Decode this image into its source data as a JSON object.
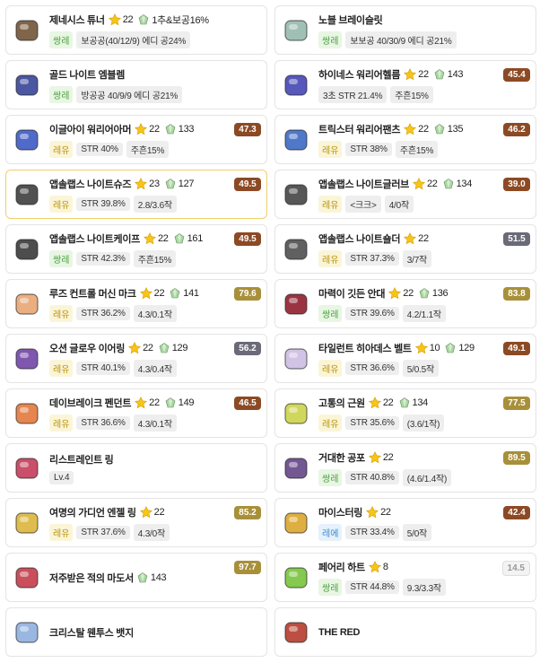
{
  "items": [
    {
      "name": "제네시스 튜너",
      "stars": "22",
      "pot": "1추&보공16%",
      "grade": "쌍레",
      "grade_type": "legend",
      "stats": [
        "보공공(40/12/9) 에디 공24%"
      ],
      "icon": "genesis-tuner-icon",
      "icon_color": "#6b4a2a"
    },
    {
      "name": "노블 브레이슬릿",
      "grade": "쌍레",
      "grade_type": "legend",
      "stats": [
        "보보공 40/30/9 에디 공21%"
      ],
      "icon": "noble-bracelet-icon",
      "icon_color": "#8fb5a8"
    },
    {
      "name": "골드 나이트 엠블렘",
      "grade": "쌍레",
      "grade_type": "legend",
      "stats": [
        "방공공 40/9/9 에디 공21%"
      ],
      "icon": "gold-knight-emblem-icon",
      "icon_color": "#2b3a8f"
    },
    {
      "name": "하이네스 워리어헬름",
      "stars": "22",
      "pot": "143",
      "grade": "3초 STR 21.4%",
      "grade_type": "chip",
      "stats": [
        "주흔15%"
      ],
      "score": "45.4",
      "score_type": "brown",
      "icon": "warrior-helm-icon",
      "icon_color": "#3a3ab0"
    },
    {
      "name": "이글아이 워리어아머",
      "stars": "22",
      "pot": "133",
      "grade": "레유",
      "grade_type": "unique",
      "stats": [
        "STR 40%",
        "주흔15%"
      ],
      "score": "47.3",
      "score_type": "brown",
      "icon": "warrior-armor-icon",
      "icon_color": "#3050c0"
    },
    {
      "name": "트릭스터 워리어팬츠",
      "stars": "22",
      "pot": "135",
      "grade": "레유",
      "grade_type": "unique",
      "stats": [
        "STR 38%",
        "주흔15%"
      ],
      "score": "46.2",
      "score_type": "brown",
      "icon": "warrior-pants-icon",
      "icon_color": "#3060c0"
    },
    {
      "name": "앱솔랩스 나이트슈즈",
      "stars": "23",
      "pot": "127",
      "grade": "레유",
      "grade_type": "unique",
      "stats": [
        "STR 39.8%",
        "2.8/3.6작"
      ],
      "score": "49.5",
      "score_type": "brown",
      "icon": "knight-shoes-icon",
      "icon_color": "#333333",
      "selected": true
    },
    {
      "name": "앱솔랩스 나이트글러브",
      "stars": "22",
      "pot": "134",
      "grade": "레유",
      "grade_type": "unique",
      "stats": [
        "<크크>",
        "4/0작"
      ],
      "score": "39.0",
      "score_type": "brown",
      "icon": "knight-glove-icon",
      "icon_color": "#3a3a3a"
    },
    {
      "name": "앱솔랩스 나이트케이프",
      "stars": "22",
      "pot": "161",
      "grade": "쌍레",
      "grade_type": "legend",
      "stats": [
        "STR 42.3%",
        "주흔15%"
      ],
      "score": "49.5",
      "score_type": "brown",
      "icon": "knight-cape-icon",
      "icon_color": "#2e2e2e"
    },
    {
      "name": "앱솔랩스 나이트숄더",
      "stars": "22",
      "grade": "레유",
      "grade_type": "unique",
      "stats": [
        "STR 37.3%",
        "3/7작"
      ],
      "score": "51.5",
      "score_type": "gray",
      "icon": "knight-shoulder-icon",
      "icon_color": "#444444"
    },
    {
      "name": "루즈 컨트롤 머신 마크",
      "stars": "22",
      "pot": "141",
      "grade": "레유",
      "grade_type": "unique",
      "stats": [
        "STR 36.2%",
        "4.3/0.1작"
      ],
      "score": "79.6",
      "score_type": "gold",
      "icon": "machine-mark-icon",
      "icon_color": "#e6a06a"
    },
    {
      "name": "마력이 깃든 안대",
      "stars": "22",
      "pot": "136",
      "grade": "쌍레",
      "grade_type": "legend",
      "stats": [
        "STR 39.6%",
        "4.2/1.1작"
      ],
      "score": "83.8",
      "score_type": "gold",
      "icon": "eye-patch-icon",
      "icon_color": "#8a1020"
    },
    {
      "name": "오션 글로우 이어링",
      "stars": "22",
      "pot": "129",
      "grade": "레유",
      "grade_type": "unique",
      "stats": [
        "STR 40.1%",
        "4.3/0.4작"
      ],
      "score": "56.2",
      "score_type": "gray",
      "icon": "earring-icon",
      "icon_color": "#6a3aa0"
    },
    {
      "name": "타일런트 히아데스 벨트",
      "stars": "10",
      "pot": "129",
      "grade": "레유",
      "grade_type": "unique",
      "stats": [
        "STR 36.6%",
        "5/0.5작"
      ],
      "score": "49.1",
      "score_type": "brown",
      "icon": "belt-icon",
      "icon_color": "#c8b8e0"
    },
    {
      "name": "데이브레이크 펜던트",
      "stars": "22",
      "pot": "149",
      "grade": "레유",
      "grade_type": "unique",
      "stats": [
        "STR 36.6%",
        "4.3/0.1작"
      ],
      "score": "46.5",
      "score_type": "brown",
      "icon": "pendant-icon",
      "icon_color": "#e07030"
    },
    {
      "name": "고통의 근원",
      "stars": "22",
      "pot": "134",
      "grade": "레유",
      "grade_type": "unique",
      "stats": [
        "STR 35.6%",
        "(3.6/1작)"
      ],
      "score": "77.5",
      "score_type": "gold",
      "icon": "source-of-pain-icon",
      "icon_color": "#c8d040"
    },
    {
      "name": "리스트레인트 링",
      "grade": "Lv.4",
      "grade_type": "chip",
      "stats": [],
      "icon": "restraint-ring-icon",
      "icon_color": "#c03050"
    },
    {
      "name": "거대한 공포",
      "stars": "22",
      "grade": "쌍레",
      "grade_type": "legend",
      "stats": [
        "STR 40.8%",
        "(4.6/1.4작)"
      ],
      "score": "89.5",
      "score_type": "gold",
      "icon": "great-fear-icon",
      "icon_color": "#5a3a80"
    },
    {
      "name": "여명의 가디언 엔젤 링",
      "stars": "22",
      "grade": "레유",
      "grade_type": "unique",
      "stats": [
        "STR 37.6%",
        "4.3/0작"
      ],
      "score": "85.2",
      "score_type": "gold",
      "icon": "angel-ring-icon",
      "icon_color": "#d8b030"
    },
    {
      "name": "마이스터링",
      "stars": "22",
      "grade": "레에",
      "grade_type": "epic",
      "stats": [
        "STR 33.4%",
        "5/0작"
      ],
      "score": "42.4",
      "score_type": "brown",
      "icon": "meister-ring-icon",
      "icon_color": "#d8a020"
    },
    {
      "name": "저주받은 적의 마도서",
      "pot": "143",
      "icon": "cursed-book-icon",
      "icon_color": "#c03040",
      "stats": [],
      "score": "97.7",
      "score_type": "gold"
    },
    {
      "name": "페어리 하트",
      "stars": "8",
      "grade": "쌍레",
      "grade_type": "legend",
      "stats": [
        "STR 44.8%",
        "9.3/3.3작"
      ],
      "score": "14.5",
      "score_type": "light",
      "icon": "fairy-heart-icon",
      "icon_color": "#70c030"
    },
    {
      "name": "크리스탈 웬투스 뱃지",
      "icon": "crystal-badge-icon",
      "icon_color": "#88aadd",
      "stats": []
    },
    {
      "name": "THE RED",
      "icon": "the-red-medal-icon",
      "icon_color": "#b03020",
      "stats": []
    }
  ]
}
